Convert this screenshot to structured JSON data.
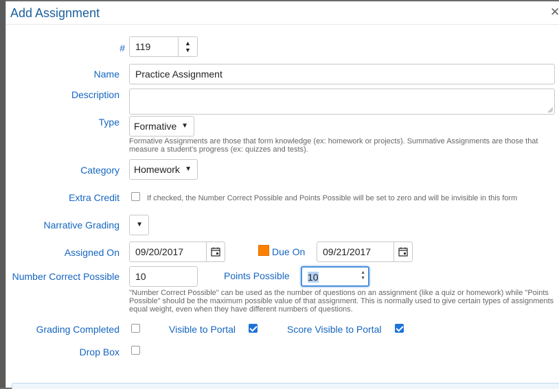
{
  "dialog": {
    "title": "Add Assignment"
  },
  "icons": {
    "close": "close-icon",
    "calendar": "calendar-icon",
    "caret": "chevron-down-icon",
    "spinner": "spinner-icon"
  },
  "colors": {
    "label": "#1565c0",
    "check_accent": "#1e73d8",
    "due_flag": "#ff7f00"
  },
  "fields": {
    "number": {
      "label": "#",
      "value": "119"
    },
    "name": {
      "label": "Name",
      "value": "Practice Assignment"
    },
    "description": {
      "label": "Description",
      "value": ""
    },
    "type": {
      "label": "Type",
      "value": "Formative",
      "help": "Formative Assignments are those that form knowledge (ex: homework or projects). Summative Assignments are those that measure a student's progress (ex: quizzes and tests)."
    },
    "category": {
      "label": "Category",
      "value": "Homework"
    },
    "extra_credit": {
      "label": "Extra Credit",
      "checked": false,
      "help": "If checked, the Number Correct Possible and Points Possible will be set to zero and will be invisible in this form"
    },
    "narrative_grading": {
      "label": "Narrative Grading",
      "value": ""
    },
    "assigned_on": {
      "label": "Assigned On",
      "value": "09/20/2017"
    },
    "due_on": {
      "label": "Due On",
      "value": "09/21/2017"
    },
    "number_correct_possible": {
      "label": "Number Correct Possible",
      "value": "10"
    },
    "points_possible": {
      "label": "Points Possible",
      "value": "10"
    },
    "points_help": "\"Number Correct Possible\" can be used as the number of questions on an assignment (like a quiz or homework) while \"Points Possible\" should be the maximum possible value of that assignment. This is normally used to give certain types of assignments equal weight, even when they have different numbers of questions.",
    "grading_completed": {
      "label": "Grading Completed",
      "checked": false
    },
    "visible_to_portal": {
      "label": "Visible to Portal",
      "checked": true
    },
    "score_visible_to_portal": {
      "label": "Score Visible to Portal",
      "checked": true
    },
    "drop_box": {
      "label": "Drop Box",
      "checked": false
    }
  }
}
